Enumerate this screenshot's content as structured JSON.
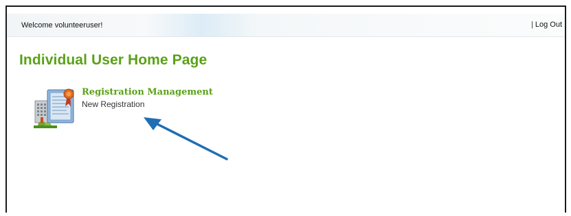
{
  "header": {
    "welcome_text": "Welcome volunteeruser!",
    "logout_separator": "|",
    "logout_label": "Log Out"
  },
  "main": {
    "page_title": "Individual User Home Page",
    "modules": [
      {
        "title": "Registration Management",
        "icon": "certificate-document-icon",
        "links": [
          "New Registration"
        ]
      }
    ]
  },
  "annotation": {
    "type": "arrow",
    "color": "#1f6eb3",
    "points_to": "New Registration"
  },
  "colors": {
    "title_green": "#5aa117",
    "text_dark": "#111111",
    "arrow_blue": "#1f6eb3"
  }
}
